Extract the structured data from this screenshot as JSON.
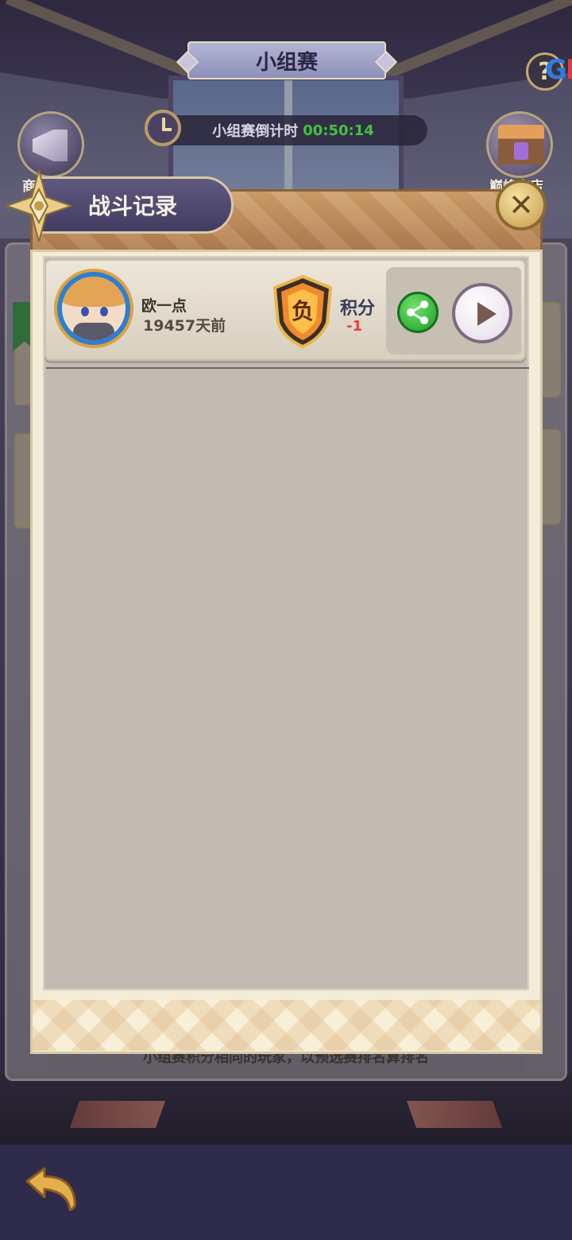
{
  "header": {
    "title": "小组赛",
    "countdown_label": "小组赛倒计时",
    "countdown_time": "00:50:14"
  },
  "brand": {
    "text_blue": "G",
    "text_red": "H"
  },
  "side_buttons": {
    "shop_label": "巅峰商店",
    "left_label": "商"
  },
  "background_hint": "小组赛积分相同的玩家，以预选赛排名算排名",
  "modal": {
    "title": "战斗记录",
    "close_symbol": "✕",
    "records": [
      {
        "player_name": "欧一点",
        "time_ago": "19457天前",
        "result": "负",
        "score_label": "积分",
        "score_change": "-1"
      }
    ]
  },
  "colors": {
    "countdown_time": "#44c23f",
    "score_negative": "#e43f3f",
    "share_green": "#1e9b2a",
    "modal_bg": "#f3ecd6"
  }
}
